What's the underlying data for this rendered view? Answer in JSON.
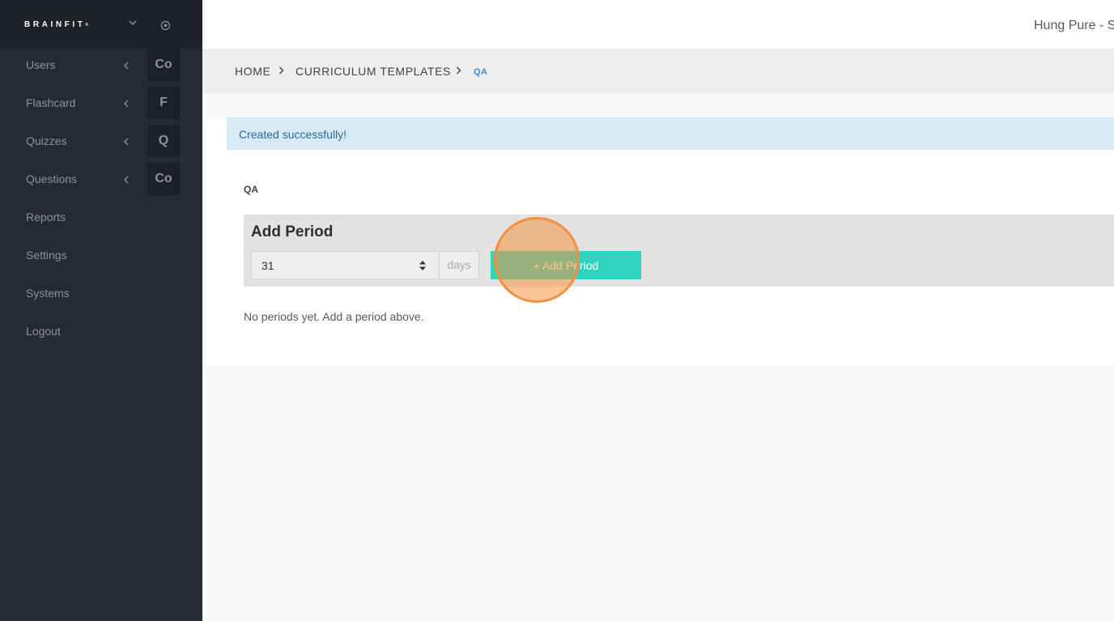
{
  "sidebar": {
    "brand": "BRAINFIT",
    "brand_mark": "®",
    "items": [
      {
        "label": "Users",
        "badge": "Co",
        "has_chevron": true
      },
      {
        "label": "Flashcard",
        "badge": "F",
        "has_chevron": true
      },
      {
        "label": "Quizzes",
        "badge": "Q",
        "has_chevron": true
      },
      {
        "label": "Questions",
        "badge": "Co",
        "has_chevron": true
      },
      {
        "label": "Reports"
      },
      {
        "label": "Settings"
      },
      {
        "label": "Systems"
      },
      {
        "label": "Logout"
      }
    ]
  },
  "header": {
    "user_name": "Hung Pure - S"
  },
  "breadcrumb": {
    "home": "HOME",
    "templates": "CURRICULUM TEMPLATES",
    "current": "QA"
  },
  "alert": {
    "message": "Created successfully!"
  },
  "main": {
    "section_title": "QA",
    "period_heading": "Add Period",
    "days_value": "31",
    "days_unit": "days",
    "add_button_label": "+ Add Period",
    "empty_message": "No periods yet. Add a period above."
  },
  "colors": {
    "sidebar_bg": "#262a33",
    "accent": "#2fd3c0",
    "alert_bg": "#d7eaf6",
    "click_indicator": "#f2913d"
  },
  "icons": {
    "brand_dropdown": "chevron-down-icon",
    "brand_action": "target-icon",
    "nav_expand": "chevron-left-icon",
    "breadcrumb_separator": "chevron-right-icon",
    "number_spinner": "spinner-icon"
  }
}
